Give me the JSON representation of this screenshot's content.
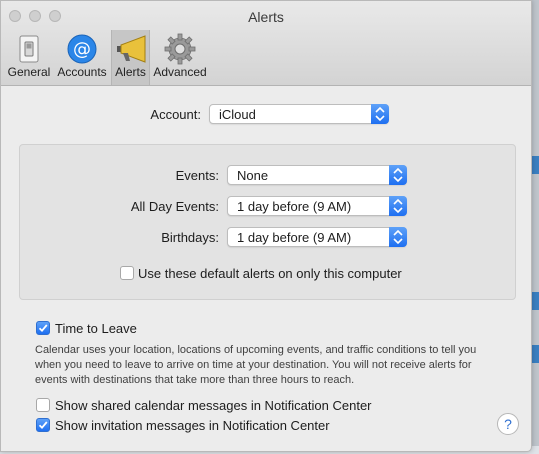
{
  "window": {
    "title": "Alerts"
  },
  "toolbar": {
    "tabs": [
      {
        "label": "General",
        "icon": "switch-icon"
      },
      {
        "label": "Accounts",
        "icon": "at-sign-icon"
      },
      {
        "label": "Alerts",
        "icon": "megaphone-icon",
        "selected": true
      },
      {
        "label": "Advanced",
        "icon": "gear-icon"
      }
    ]
  },
  "account": {
    "label": "Account:",
    "value": "iCloud"
  },
  "defaults": {
    "events": {
      "label": "Events:",
      "value": "None"
    },
    "all_day_events": {
      "label": "All Day Events:",
      "value": "1 day before (9 AM)"
    },
    "birthdays": {
      "label": "Birthdays:",
      "value": "1 day before (9 AM)"
    },
    "only_this_computer": {
      "label": "Use these default alerts on only this computer",
      "checked": false
    }
  },
  "time_to_leave": {
    "label": "Time to Leave",
    "checked": true,
    "description": "Calendar uses your location, locations of upcoming events, and traffic conditions to tell you when you need to leave to arrive on time at your destination. You will not receive alerts for events with destinations that take more than three hours to reach."
  },
  "shared_calendar_messages": {
    "label": "Show shared calendar messages in Notification Center",
    "checked": false
  },
  "invitation_messages": {
    "label": "Show invitation messages in Notification Center",
    "checked": true
  },
  "help": {
    "label": "?"
  },
  "colors": {
    "accent": "#1e6ff1",
    "window_bg": "#ececec",
    "group_bg": "#e3e3e3"
  }
}
